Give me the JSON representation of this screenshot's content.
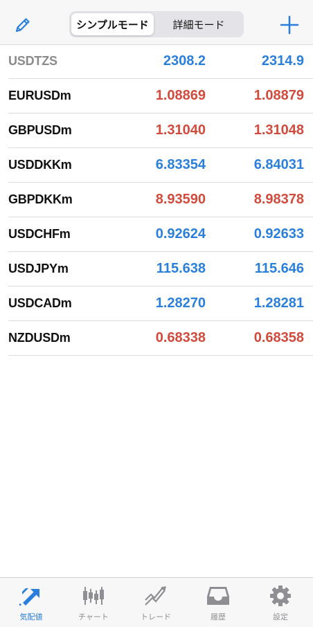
{
  "header": {
    "edit_icon": "pencil-icon",
    "segments": [
      "シンプルモード",
      "詳細モード"
    ],
    "active_segment": "シンプルモード",
    "add_icon": "plus-icon"
  },
  "colors": {
    "price_up": "#2a7fdc",
    "price_down": "#d24a3c",
    "accent": "#2a7fdc",
    "inactive": "#8e8e93"
  },
  "quotes": [
    {
      "symbol": "USDTZS",
      "bid": "2308.2",
      "ask": "2314.9",
      "direction": "up",
      "disabled": true
    },
    {
      "symbol": "EURUSDm",
      "bid": "1.08869",
      "ask": "1.08879",
      "direction": "down",
      "disabled": false
    },
    {
      "symbol": "GBPUSDm",
      "bid": "1.31040",
      "ask": "1.31048",
      "direction": "down",
      "disabled": false
    },
    {
      "symbol": "USDDKKm",
      "bid": "6.83354",
      "ask": "6.84031",
      "direction": "up",
      "disabled": false
    },
    {
      "symbol": "GBPDKKm",
      "bid": "8.93590",
      "ask": "8.98378",
      "direction": "down",
      "disabled": false
    },
    {
      "symbol": "USDCHFm",
      "bid": "0.92624",
      "ask": "0.92633",
      "direction": "up",
      "disabled": false
    },
    {
      "symbol": "USDJPYm",
      "bid": "115.638",
      "ask": "115.646",
      "direction": "up",
      "disabled": false
    },
    {
      "symbol": "USDCADm",
      "bid": "1.28270",
      "ask": "1.28281",
      "direction": "up",
      "disabled": false
    },
    {
      "symbol": "NZDUSDm",
      "bid": "0.68338",
      "ask": "0.68358",
      "direction": "down",
      "disabled": false
    }
  ],
  "tabbar": {
    "tabs": [
      {
        "label": "気配値",
        "icon": "quotes-arrows-icon",
        "active": true
      },
      {
        "label": "チャート",
        "icon": "candlestick-chart-icon",
        "active": false
      },
      {
        "label": "トレード",
        "icon": "trade-chart-icon",
        "active": false
      },
      {
        "label": "履歴",
        "icon": "inbox-tray-icon",
        "active": false
      },
      {
        "label": "設定",
        "icon": "gear-icon",
        "active": false
      }
    ]
  }
}
